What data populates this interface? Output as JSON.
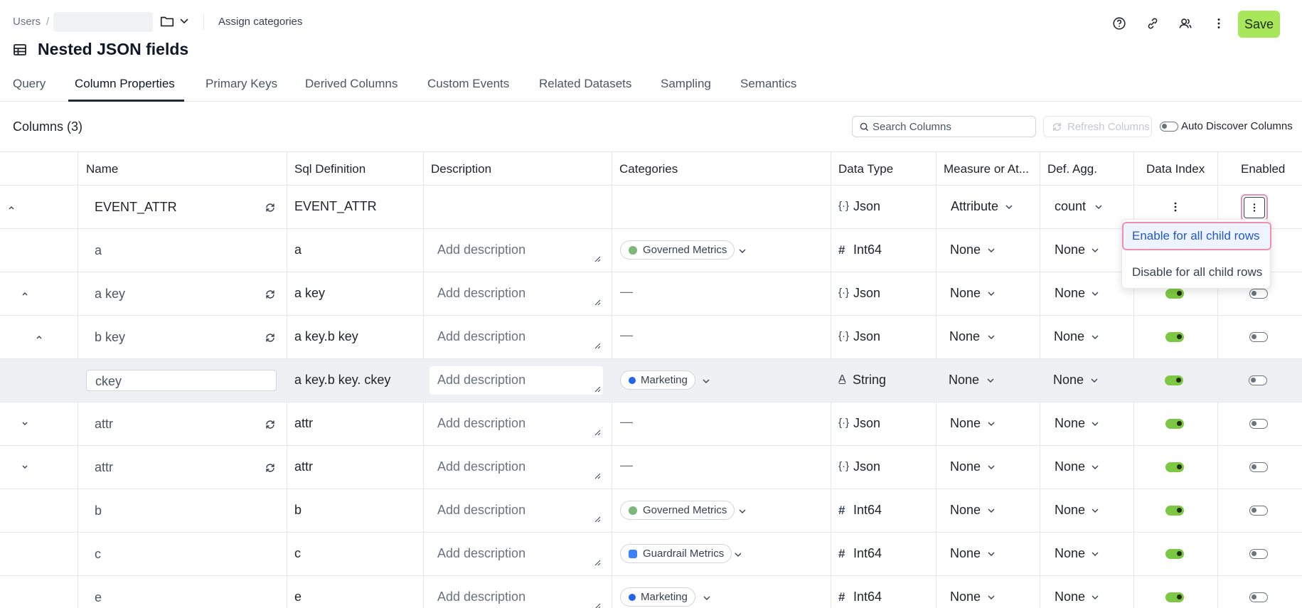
{
  "breadcrumb": {
    "root": "Users",
    "sep": "/"
  },
  "header": {
    "assign_label": "Assign categories",
    "save_label": "Save",
    "title": "Nested JSON fields"
  },
  "tabs": [
    "Query",
    "Column Properties",
    "Primary Keys",
    "Derived Columns",
    "Custom Events",
    "Related Datasets",
    "Sampling",
    "Semantics"
  ],
  "active_tab": "Column Properties",
  "toolbar": {
    "columns_count": "Columns (3)",
    "search_placeholder": "Search Columns",
    "refresh_label": "Refresh Columns",
    "auto_discover_label": "Auto Discover Columns"
  },
  "columns": [
    "Name",
    "Sql Definition",
    "Description",
    "Categories",
    "Data Type",
    "Measure or At...",
    "Def. Agg.",
    "Data Index",
    "Enabled"
  ],
  "rows": [
    {
      "name": "EVENT_ATTR",
      "sql": "EVENT_ATTR",
      "desc": "",
      "category": "",
      "type": "Json",
      "measure": "Attribute",
      "agg": "count"
    },
    {
      "name": "a",
      "sql": "a",
      "desc": "Add description",
      "category": "Governed Metrics",
      "type": "Int64",
      "measure": "None",
      "agg": "None"
    },
    {
      "name": "a key",
      "sql": "a key",
      "desc": "Add description",
      "category": "—",
      "type": "Json",
      "measure": "None",
      "agg": "None"
    },
    {
      "name": "b key",
      "sql": "a key.b key",
      "desc": "Add description",
      "category": "—",
      "type": "Json",
      "measure": "None",
      "agg": "None"
    },
    {
      "name": "ckey",
      "sql": "a key.b key. ckey",
      "desc": "Add description",
      "category": "Marketing",
      "type": "String",
      "measure": "None",
      "agg": "None"
    },
    {
      "name": "attr",
      "sql": "attr",
      "desc": "Add description",
      "category": "—",
      "type": "Json",
      "measure": "None",
      "agg": "None"
    },
    {
      "name": "attr",
      "sql": "attr",
      "desc": "Add description",
      "category": "—",
      "type": "Json",
      "measure": "None",
      "agg": "None"
    },
    {
      "name": "b",
      "sql": "b",
      "desc": "Add description",
      "category": "Governed Metrics",
      "type": "Int64",
      "measure": "None",
      "agg": "None"
    },
    {
      "name": "c",
      "sql": "c",
      "desc": "Add description",
      "category": "Guardrail Metrics",
      "type": "Int64",
      "measure": "None",
      "agg": "None"
    },
    {
      "name": "e",
      "sql": "e",
      "desc": "Add description",
      "category": "Marketing",
      "type": "Int64",
      "measure": "None",
      "agg": "None"
    }
  ],
  "menu": {
    "enable_label": "Enable for all child rows",
    "disable_label": "Disable for all child rows"
  },
  "colors": {
    "accent": "#a8e65a",
    "toggle_on": "#7cc743",
    "highlight": "#ef8fb0",
    "link": "#2457c5",
    "governed": "#7cb87c",
    "guardrail": "#3b82f6",
    "marketing": "#2563eb"
  }
}
